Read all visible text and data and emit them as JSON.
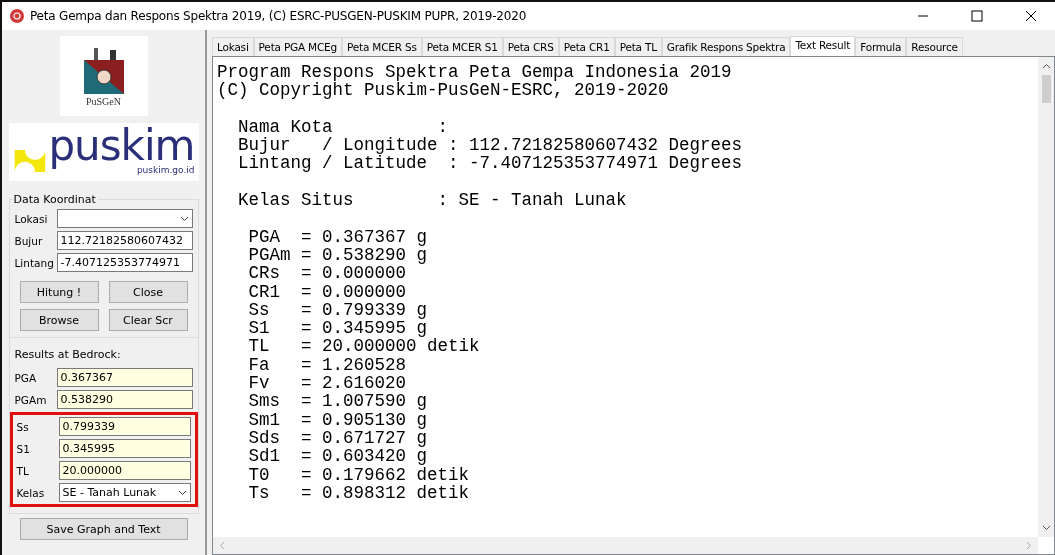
{
  "window": {
    "title": "Peta Gempa dan Respons Spektra 2019, (C) ESRC-PUSGEN-PUSKIM PUPR, 2019-2020"
  },
  "logos": {
    "pusgen": "PuSGeN",
    "puskim": "puskim",
    "puskim_url": "puskim.go.id"
  },
  "data_koordinat": {
    "title": "Data Koordinat",
    "fields": [
      {
        "kind": "dropdown",
        "label": "Lokasi"
      },
      {
        "kind": "text",
        "label": "Bujur",
        "value": "112.72182580607432"
      },
      {
        "kind": "text",
        "label": "Lintang",
        "value": "-7.407125353774971"
      }
    ],
    "buttons": [
      "Hitung !",
      "Close",
      "Browse",
      "Clear Scr"
    ]
  },
  "results": {
    "title": "Results at Bedrock:",
    "fields": [
      {
        "kind": "text",
        "label": "PGA",
        "value": "0.367367"
      },
      {
        "kind": "text",
        "label": "PGAm",
        "value": "0.538290"
      }
    ],
    "highlighted_fields": [
      {
        "kind": "text",
        "label": "Ss",
        "value": "0.799339"
      },
      {
        "kind": "text",
        "label": "S1",
        "value": "0.345995"
      },
      {
        "kind": "text",
        "label": "TL",
        "value": "20.000000"
      },
      {
        "kind": "dropdown",
        "label": "Kelas",
        "value": "SE - Tanah Lunak"
      }
    ]
  },
  "save_button": "Save Graph and Text",
  "tabs": [
    {
      "label": "Lokasi",
      "selected": false
    },
    {
      "label": "Peta PGA MCEg",
      "selected": false
    },
    {
      "label": "Peta MCER Ss",
      "selected": false
    },
    {
      "label": "Peta MCER S1",
      "selected": false
    },
    {
      "label": "Peta CRS",
      "selected": false
    },
    {
      "label": "Peta CR1",
      "selected": false
    },
    {
      "label": "Peta TL",
      "selected": false
    },
    {
      "label": "Grafik Respons Spektra",
      "selected": false
    },
    {
      "label": "Text Result",
      "selected": true
    },
    {
      "label": "Formula",
      "selected": false
    },
    {
      "label": "Resource",
      "selected": false
    }
  ],
  "text_result": [
    [
      "Program Respons Spektra Peta Gempa Indonesia 2019",
      "(C) Copyright Puskim-PusGeN-ESRC, 2019-2020"
    ],
    [
      "  Nama Kota          :",
      "  Bujur   / Longitude : 112.72182580607432 Degrees",
      "  Lintang / Latitude  : -7.407125353774971 Degrees"
    ],
    [
      "  Kelas Situs        : SE - Tanah Lunak"
    ],
    [
      "   PGA  = 0.367367 g",
      "   PGAm = 0.538290 g",
      "   CRs  = 0.000000",
      "   CR1  = 0.000000",
      "   Ss   = 0.799339 g",
      "   S1   = 0.345995 g",
      "   TL   = 20.000000 detik",
      "   Fa   = 1.260528",
      "   Fv   = 2.616020",
      "   Sms  = 1.007590 g",
      "   Sm1  = 0.905130 g",
      "   Sds  = 0.671727 g",
      "   Sd1  = 0.603420 g",
      "   T0   = 0.179662 detik",
      "   Ts   = 0.898312 detik"
    ]
  ]
}
